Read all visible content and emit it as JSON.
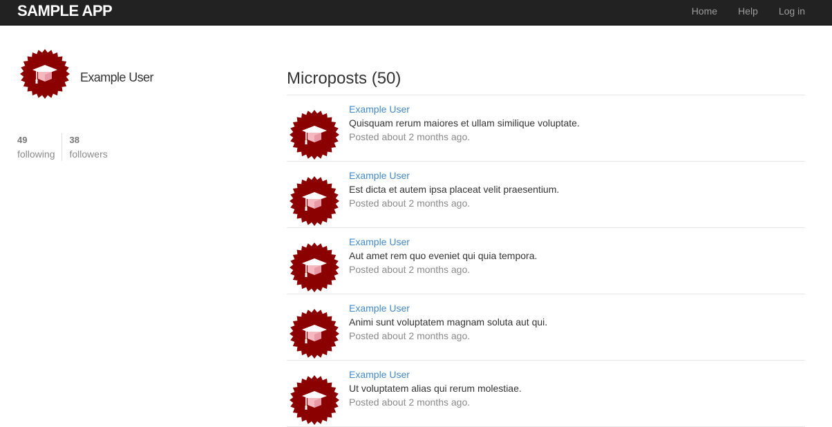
{
  "header": {
    "logo": "SAMPLE APP",
    "nav": [
      {
        "label": "Home"
      },
      {
        "label": "Help"
      },
      {
        "label": "Log in"
      }
    ]
  },
  "profile": {
    "name": "Example User",
    "avatar_icon": "graduation-cap-badge-icon",
    "following": {
      "count": "49",
      "label": "following"
    },
    "followers": {
      "count": "38",
      "label": "followers"
    }
  },
  "feed": {
    "title": "Microposts (50)",
    "posts": [
      {
        "user": "Example User",
        "content": "Quisquam rerum maiores et ullam similique voluptate.",
        "timestamp": "Posted about 2 months ago."
      },
      {
        "user": "Example User",
        "content": "Est dicta et autem ipsa placeat velit praesentium.",
        "timestamp": "Posted about 2 months ago."
      },
      {
        "user": "Example User",
        "content": "Aut amet rem quo eveniet qui quia tempora.",
        "timestamp": "Posted about 2 months ago."
      },
      {
        "user": "Example User",
        "content": "Animi sunt voluptatem magnam soluta aut qui.",
        "timestamp": "Posted about 2 months ago."
      },
      {
        "user": "Example User",
        "content": "Ut voluptatem alias qui rerum molestiae.",
        "timestamp": "Posted about 2 months ago."
      }
    ]
  },
  "colors": {
    "navbar_bg": "#222222",
    "link": "#428bca",
    "badge": "#8b0000"
  }
}
